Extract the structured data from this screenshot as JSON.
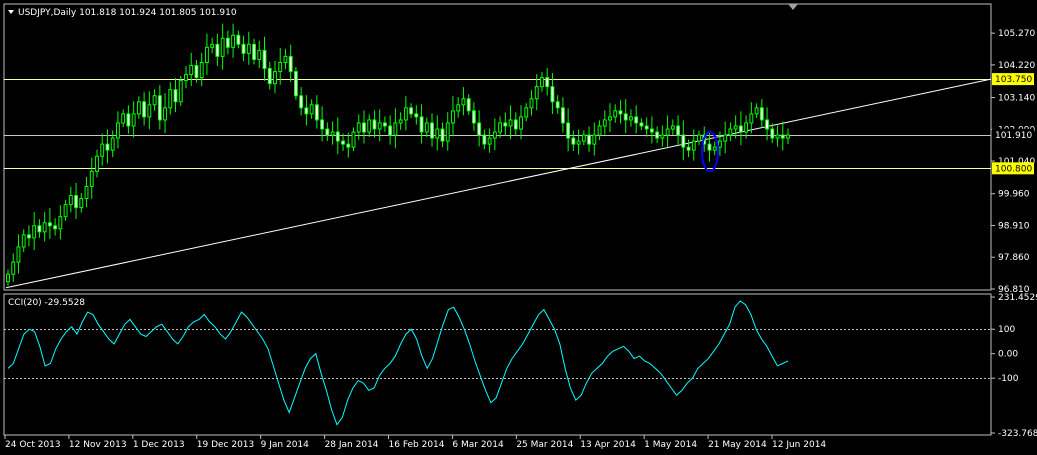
{
  "chart_data": [
    {
      "type": "candlestick",
      "header": "USDJPY,Daily  101.818 101.924 101.805 101.910",
      "symbol": "USDJPY",
      "timeframe": "Daily",
      "ohlc_current": {
        "open": 101.818,
        "high": 101.924,
        "low": 101.805,
        "close": 101.91
      },
      "ylim": [
        96.81,
        106.2
      ],
      "y_ticks": [
        "105.270",
        "104.220",
        "103.140",
        "102.090",
        "101.040",
        "99.960",
        "98.910",
        "97.860",
        "96.810"
      ],
      "x_ticks": [
        "24 Oct 2013",
        "12 Nov 2013",
        "1 Dec 2013",
        "19 Dec 2013",
        "9 Jan 2014",
        "28 Jan 2014",
        "16 Feb 2014",
        "6 Mar 2014",
        "25 Mar 2014",
        "13 Apr 2014",
        "1 May 2014",
        "21 May 2014",
        "12 Jun 2014"
      ],
      "price_label": "101.910",
      "horizontal_levels": [
        {
          "value": 103.75,
          "label": "103.750",
          "color": "#ffff99"
        },
        {
          "value": 101.91,
          "label": "101.910",
          "color": "#c8c8c8"
        },
        {
          "value": 100.8,
          "label": "100.800",
          "color": "#ffff99"
        }
      ],
      "trendline": {
        "from": {
          "date": "24 Oct 2013",
          "value": 96.85
        },
        "to_value_at_right_edge": 103.75
      },
      "annotation": {
        "shape": "ellipse",
        "color": "#0000ff",
        "near_date": "19 May 2014",
        "price_range": [
          100.7,
          102.0
        ]
      },
      "closes": [
        97.3,
        97.7,
        98.2,
        98.6,
        98.5,
        98.9,
        98.7,
        99.0,
        98.9,
        98.8,
        99.2,
        99.6,
        99.9,
        99.5,
        99.8,
        100.2,
        100.7,
        101.2,
        101.6,
        101.4,
        101.8,
        102.3,
        102.6,
        102.2,
        102.6,
        103.0,
        102.5,
        102.9,
        103.2,
        102.4,
        102.8,
        103.4,
        103.0,
        103.7,
        103.9,
        104.2,
        103.8,
        104.3,
        104.8,
        104.9,
        104.5,
        105.1,
        104.8,
        105.2,
        104.9,
        104.6,
        104.9,
        104.4,
        104.7,
        104.1,
        103.6,
        104.0,
        104.3,
        104.5,
        104.0,
        103.2,
        102.8,
        102.6,
        102.9,
        102.4,
        102.1,
        101.9,
        102.0,
        101.7,
        101.6,
        101.5,
        102.0,
        102.3,
        102.0,
        102.4,
        102.1,
        102.3,
        102.2,
        101.9,
        102.3,
        102.4,
        102.8,
        102.6,
        102.5,
        102.0,
        102.3,
        101.8,
        102.1,
        101.7,
        102.3,
        102.7,
        102.9,
        103.1,
        102.7,
        102.3,
        101.9,
        101.6,
        101.8,
        102.0,
        102.3,
        102.2,
        102.4,
        102.1,
        102.5,
        102.8,
        103.1,
        103.5,
        103.8,
        103.5,
        103.0,
        102.8,
        102.3,
        101.8,
        101.6,
        101.7,
        101.9,
        101.6,
        101.9,
        102.2,
        102.4,
        102.5,
        102.7,
        102.6,
        102.4,
        102.5,
        102.3,
        102.2,
        102.1,
        102.0,
        101.8,
        101.9,
        102.1,
        102.2,
        101.9,
        101.5,
        101.4,
        101.7,
        101.9,
        101.6,
        101.4,
        101.5,
        101.7,
        101.9,
        102.1,
        102.2,
        102.0,
        102.3,
        102.6,
        102.8,
        102.4,
        102.1,
        101.8,
        101.9,
        101.8,
        101.9
      ],
      "indicator": {
        "name": "CCI(20)",
        "header": "CCI(20) -29.5528",
        "value": -29.5528,
        "ylim": [
          -323.768,
          231.4529
        ],
        "y_ticks": [
          "231.4529",
          "100",
          "0.00",
          "-100",
          "-323.768"
        ],
        "levels": [
          100,
          -100
        ],
        "values": [
          -60,
          -40,
          20,
          80,
          100,
          90,
          30,
          -50,
          -40,
          20,
          60,
          90,
          110,
          80,
          130,
          170,
          160,
          120,
          90,
          60,
          40,
          80,
          120,
          140,
          110,
          80,
          70,
          90,
          110,
          120,
          90,
          60,
          40,
          70,
          110,
          130,
          140,
          160,
          130,
          110,
          80,
          60,
          90,
          130,
          170,
          150,
          120,
          90,
          60,
          20,
          -50,
          -120,
          -190,
          -240,
          -180,
          -120,
          -60,
          -20,
          0,
          -80,
          -150,
          -230,
          -290,
          -260,
          -190,
          -140,
          -110,
          -120,
          -150,
          -140,
          -90,
          -60,
          -40,
          -10,
          40,
          80,
          100,
          60,
          -10,
          -60,
          -20,
          50,
          120,
          180,
          190,
          150,
          100,
          40,
          -30,
          -90,
          -150,
          -200,
          -180,
          -120,
          -60,
          -20,
          10,
          40,
          80,
          120,
          160,
          180,
          140,
          100,
          40,
          -60,
          -140,
          -190,
          -170,
          -120,
          -80,
          -60,
          -40,
          -10,
          10,
          20,
          30,
          10,
          -20,
          -10,
          -30,
          -40,
          -60,
          -80,
          -110,
          -140,
          -170,
          -150,
          -120,
          -100,
          -60,
          -40,
          -20,
          10,
          40,
          80,
          120,
          190,
          215,
          200,
          160,
          100,
          60,
          30,
          -10,
          -50,
          -40,
          -29.5528
        ],
        "color": "#00ffff"
      }
    }
  ]
}
